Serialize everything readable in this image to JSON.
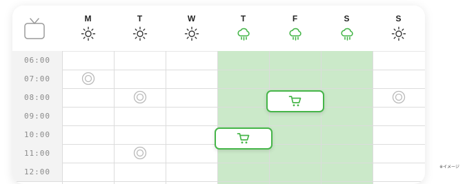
{
  "days": [
    {
      "label": "M",
      "weather": "sun-icon"
    },
    {
      "label": "T",
      "weather": "sun-icon"
    },
    {
      "label": "W",
      "weather": "sun-icon"
    },
    {
      "label": "T",
      "weather": "rain-cloud-icon"
    },
    {
      "label": "F",
      "weather": "rain-cloud-icon"
    },
    {
      "label": "S",
      "weather": "rain-cloud-icon"
    },
    {
      "label": "S",
      "weather": "sun-icon"
    }
  ],
  "times": [
    "06:00",
    "07:00",
    "08:00",
    "09:00",
    "10:00",
    "11:00",
    "12:00"
  ],
  "colors": {
    "accent": "#45b548",
    "band": "#cbe9c9",
    "sun": "#333333",
    "mark": "#b9b9b9"
  },
  "markers": [
    {
      "day": 0,
      "time": "07:00",
      "icon": "target-icon"
    },
    {
      "day": 1,
      "time": "08:00",
      "icon": "target-icon"
    },
    {
      "day": 6,
      "time": "08:00",
      "icon": "target-icon"
    },
    {
      "day": 1,
      "time": "11:00",
      "icon": "target-icon"
    }
  ],
  "cart_cards": [
    {
      "icon": "shopping-cart-icon",
      "time": "08:00"
    },
    {
      "icon": "shopping-cart-icon",
      "time": "10:00"
    }
  ],
  "footnote": "※イメージ"
}
